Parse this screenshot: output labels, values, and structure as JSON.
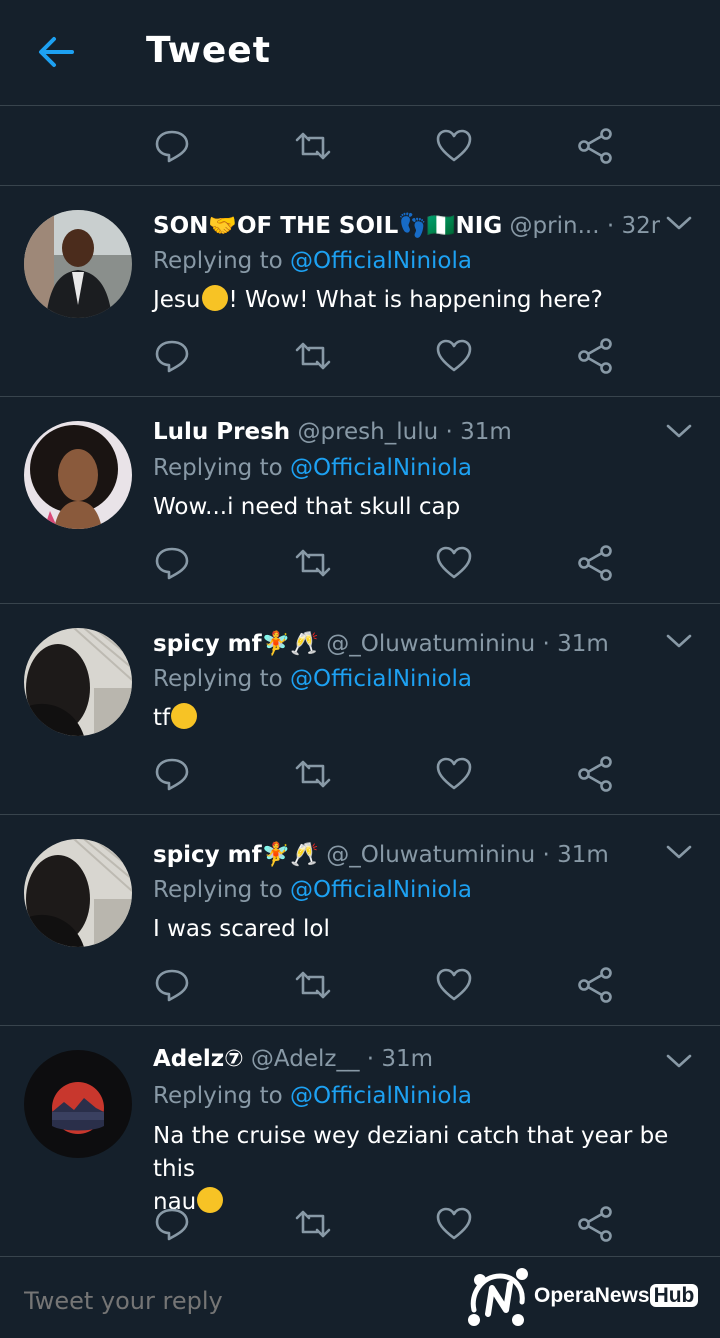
{
  "header": {
    "title": "Tweet"
  },
  "colors": {
    "background": "#15202b",
    "accent": "#1da1f2",
    "muted": "#8899a6",
    "divider": "#38444d"
  },
  "tweets": [
    {
      "name": "SON🤝OF THE SOIL👣🇳🇬NIG",
      "handle": "@prin...",
      "time": "· 32m",
      "reply_prefix": "Replying to ",
      "reply_to": "@OfficialNiniola",
      "text_before": "Jesu",
      "text_after": "! Wow! What is happening here?"
    },
    {
      "name": "Lulu Presh",
      "handle": "@presh_lulu",
      "time": "· 31m",
      "reply_prefix": "Replying to ",
      "reply_to": "@OfficialNiniola",
      "text": "Wow...i need that skull cap"
    },
    {
      "name": "spicy mf🧚🥂",
      "handle": "@_Oluwatumininu",
      "time": "· 31m",
      "reply_prefix": "Replying to ",
      "reply_to": "@OfficialNiniola",
      "text_before": "tf",
      "text_after": ""
    },
    {
      "name": "spicy mf🧚🥂",
      "handle": "@_Oluwatumininu",
      "time": "· 31m",
      "reply_prefix": "Replying to ",
      "reply_to": "@OfficialNiniola",
      "text": "I was scared lol"
    },
    {
      "name": "Adelz⑦",
      "handle": "@Adelz__",
      "time": "· 31m",
      "reply_prefix": "Replying to ",
      "reply_to": "@OfficialNiniola",
      "text_line1": "Na the cruise wey deziani catch that year be this",
      "text_line2": "nau"
    }
  ],
  "compose": {
    "placeholder": "Tweet your reply"
  },
  "watermark": {
    "brand": "OperaNews",
    "hub": "Hub"
  }
}
